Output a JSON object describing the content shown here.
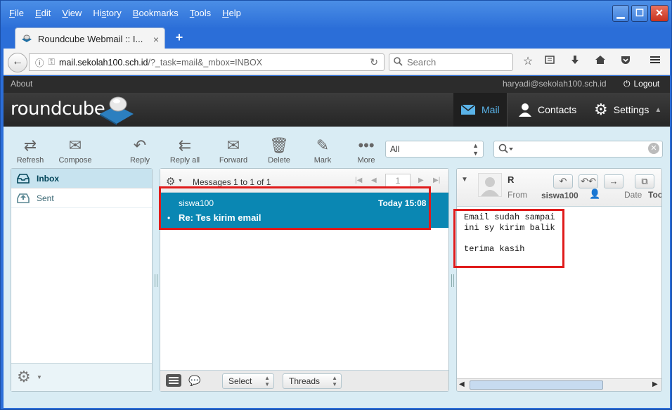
{
  "browser": {
    "menu": [
      "File",
      "Edit",
      "View",
      "History",
      "Bookmarks",
      "Tools",
      "Help"
    ],
    "menu_underline": [
      "F",
      "E",
      "V",
      "s",
      "B",
      "T",
      "H"
    ],
    "window_buttons": {
      "minimize": "▁",
      "maximize": "☐",
      "close": "✕"
    },
    "tab_title": "Roundcube Webmail :: I...",
    "tab_close": "×",
    "new_tab": "+",
    "url_host": "mail.sekolah100.sch.id",
    "url_path": "/?_task=mail&_mbox=INBOX",
    "search_placeholder": "Search"
  },
  "roundcube": {
    "about": "About",
    "user": "haryadi@sekolah100.sch.id",
    "logout": "Logout",
    "logo": "roundcube",
    "nav": {
      "mail": "Mail",
      "contacts": "Contacts",
      "settings": "Settings"
    },
    "toolbar": {
      "refresh": "Refresh",
      "compose": "Compose",
      "reply": "Reply",
      "reply_all": "Reply all",
      "forward": "Forward",
      "delete": "Delete",
      "mark": "Mark",
      "more": "More"
    },
    "filter_value": "All",
    "folders": [
      {
        "name": "Inbox",
        "selected": true
      },
      {
        "name": "Sent",
        "selected": false
      }
    ],
    "messagelist": {
      "count_text": "Messages 1 to 1 of 1",
      "page": "1",
      "rows": [
        {
          "from": "siswa100",
          "date": "Today 15:08",
          "subject": "Re: Tes kirim email",
          "bullet": "•"
        }
      ],
      "select_label": "Select",
      "threads_label": "Threads"
    },
    "preview": {
      "sender_initial": "R",
      "from_label": "From",
      "from_name": "siswa100",
      "date_label": "Date",
      "extra_label": "Too",
      "body": "Email sudah sampai\nini sy kirim balik\n\nterima kasih"
    }
  },
  "colors": {
    "selected_row": "#0a87b3",
    "highlight_box": "#e01b1b",
    "mail_nav_active": "#5ab3e8"
  }
}
